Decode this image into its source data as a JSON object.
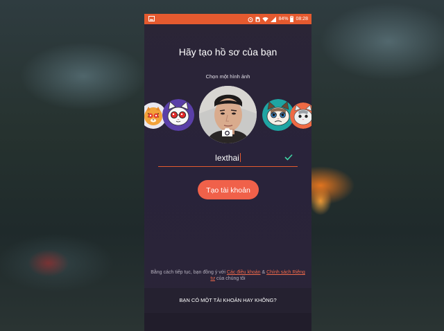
{
  "colors": {
    "accent": "#e55a2f",
    "button": "#f0614a",
    "link": "#f06a4b",
    "check": "#3fd3a4",
    "panel": "#2a2438"
  },
  "status_bar": {
    "battery": "84%",
    "time": "08:28",
    "icons": [
      "image-icon",
      "alarm-icon",
      "sim-icon",
      "wifi-icon",
      "signal-icon",
      "battery-icon"
    ]
  },
  "profile": {
    "title": "Hãy tạo hồ sơ của bạn",
    "choose_image_label": "Chọn một hình ảnh",
    "avatars": [
      "tiger-avatar",
      "white-cat-avatar",
      "user-photo",
      "grumpy-cat-avatar",
      "cat-avatar"
    ],
    "camera_icon": "camera-icon"
  },
  "username": {
    "value": "lexthai",
    "valid_icon": "checkmark-icon"
  },
  "create_button": {
    "label": "Tạo tài khoản"
  },
  "terms": {
    "prefix": "Bằng cách tiếp tục, bạn đồng ý với ",
    "terms_link": "Các điều khoản",
    "amp": " & ",
    "privacy_link": "Chính sách Riêng tư",
    "suffix": " của chúng tôi"
  },
  "footer": {
    "have_account": "BẠN CÓ MỘT TÀI KHOẢN HAY KHÔNG?"
  }
}
